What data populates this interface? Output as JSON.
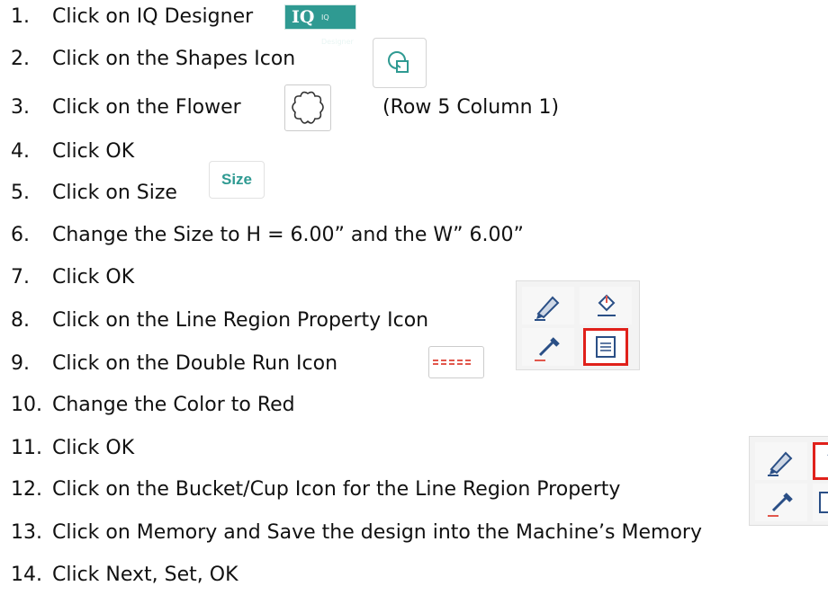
{
  "steps": [
    {
      "num": "1.",
      "text": "Click on IQ Designer"
    },
    {
      "num": "2.",
      "text": "Click on the Shapes Icon"
    },
    {
      "num": "3.",
      "text": "Click on the Flower"
    },
    {
      "num": "4.",
      "text": "Click OK"
    },
    {
      "num": "5.",
      "text": "Click on Size"
    },
    {
      "num": "6.",
      "text": "Change the Size to H = 6.00” and the W” 6.00”"
    },
    {
      "num": "7.",
      "text": "Click OK"
    },
    {
      "num": "8.",
      "text": "Click on the Line Region Property Icon"
    },
    {
      "num": "9.",
      "text": "Click on the Double Run Icon"
    },
    {
      "num": "10.",
      "text": "Change the Color to Red"
    },
    {
      "num": "11.",
      "text": "Click OK"
    },
    {
      "num": "12.",
      "text": "Click on the Bucket/Cup Icon for the Line Region Property"
    },
    {
      "num": "13.",
      "text": "Click on Memory and Save the design into the Machine’s Memory"
    },
    {
      "num": "14.",
      "text": "Click Next, Set, OK"
    }
  ],
  "notes": {
    "flower_position": "(Row 5  Column 1)"
  },
  "buttons": {
    "iq_logo": "IQ",
    "iq_label": "IQ Designer",
    "size_label": "Size"
  },
  "icons": {
    "shapes": "shapes-icon",
    "flower": "flower-icon",
    "pen": "pen-icon",
    "bucket": "bucket-icon",
    "eyedropper": "eyedropper-icon",
    "line_region_property": "line-region-property-icon",
    "double_run": "double-run-stitch-icon"
  },
  "colors": {
    "teal": "#2f9a92",
    "highlight_red": "#e0211b",
    "stitch_red": "#e2574c"
  }
}
